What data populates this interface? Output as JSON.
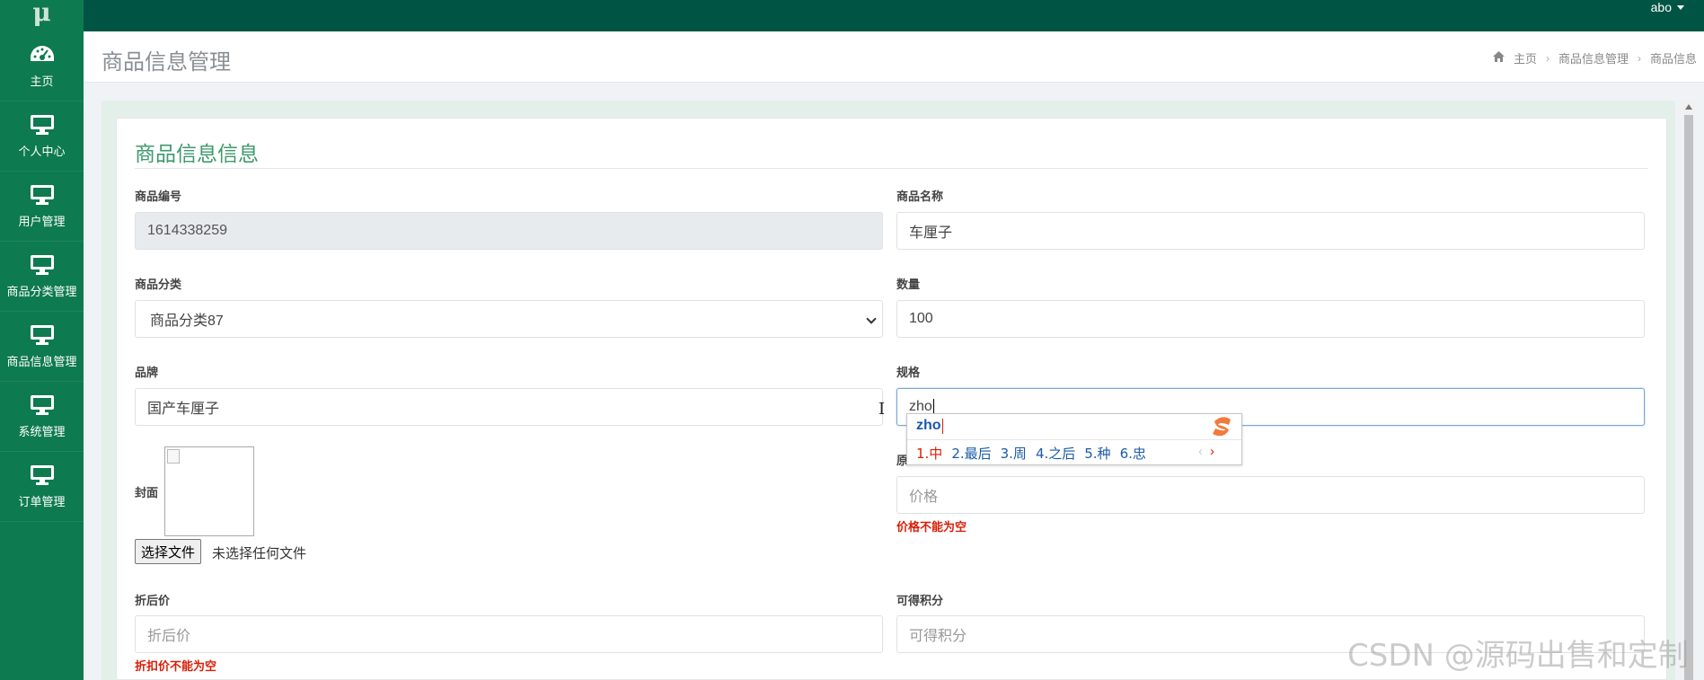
{
  "app": {
    "logo": "μ",
    "user": "abo"
  },
  "sidebar": {
    "items": [
      {
        "label": "主页",
        "icon": "dashboard-icon"
      },
      {
        "label": "个人中心",
        "icon": "monitor-icon"
      },
      {
        "label": "用户管理",
        "icon": "monitor-icon"
      },
      {
        "label": "商品分类管理",
        "icon": "monitor-icon"
      },
      {
        "label": "商品信息管理",
        "icon": "monitor-icon"
      },
      {
        "label": "系统管理",
        "icon": "monitor-icon"
      },
      {
        "label": "订单管理",
        "icon": "monitor-icon"
      }
    ]
  },
  "header": {
    "title": "商品信息管理",
    "breadcrumb": [
      "主页",
      "商品信息管理",
      "商品信息"
    ]
  },
  "form": {
    "title": "商品信息信息",
    "product_code": {
      "label": "商品编号",
      "value": "1614338259"
    },
    "product_name": {
      "label": "商品名称",
      "value": "车厘子"
    },
    "category": {
      "label": "商品分类",
      "value": "商品分类87"
    },
    "quantity": {
      "label": "数量",
      "value": "100"
    },
    "brand": {
      "label": "品牌",
      "value": "国产车厘子"
    },
    "spec": {
      "label": "规格",
      "value": "zho"
    },
    "cover": {
      "label": "封面",
      "button": "选择文件",
      "status": "未选择任何文件"
    },
    "price": {
      "label": "原",
      "placeholder": "价格",
      "error": "价格不能为空"
    },
    "discount_price": {
      "label": "折后价",
      "placeholder": "折后价",
      "error": "折扣价不能为空"
    },
    "points": {
      "label": "可得积分",
      "placeholder": "可得积分"
    }
  },
  "ime": {
    "composition": "zho",
    "candidates": [
      "1.中",
      "2.最后",
      "3.周",
      "4.之后",
      "5.种",
      "6.忠"
    ],
    "prev": "‹",
    "next": "›"
  },
  "watermark": "CSDN @源码出售和定制",
  "colors": {
    "sidebar": "#0e7a4f",
    "topbar": "#005443",
    "accent": "#3d9a6b",
    "error": "#d81e06"
  }
}
